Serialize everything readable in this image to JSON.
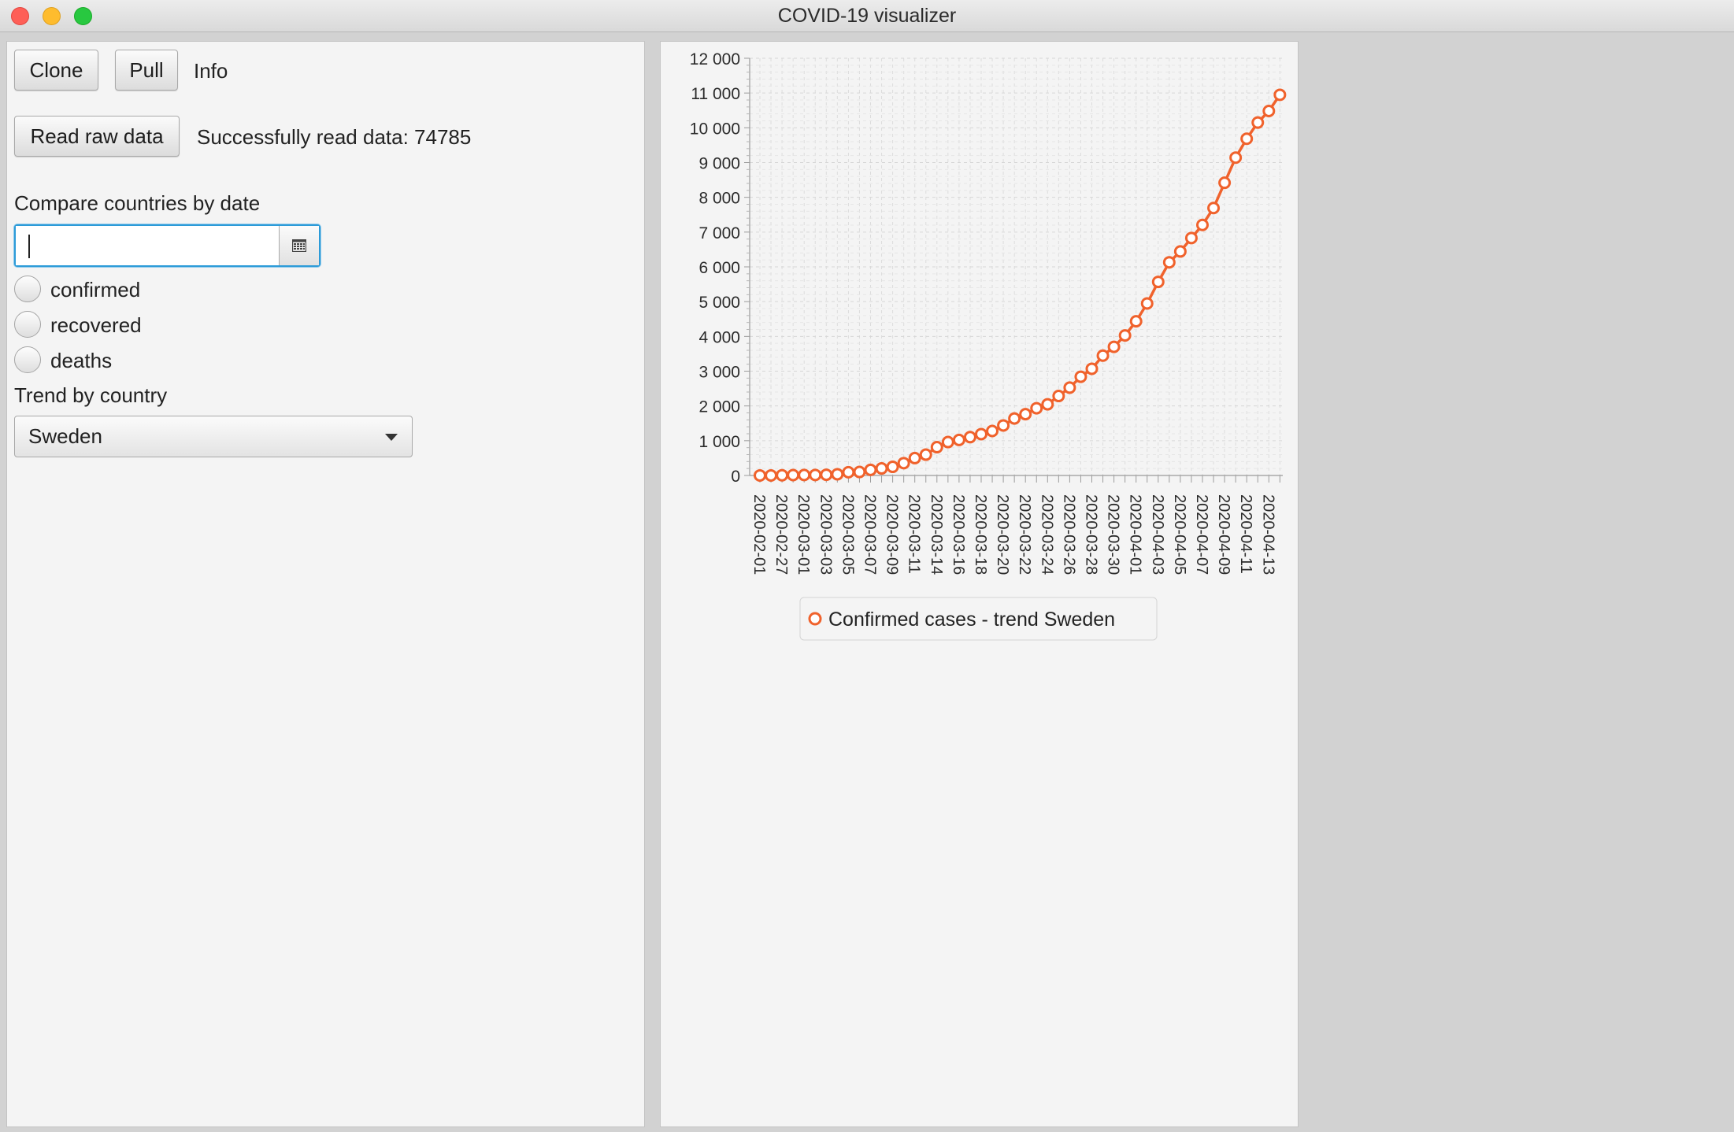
{
  "window": {
    "title": "COVID-19 visualizer"
  },
  "toolbar": {
    "clone_label": "Clone",
    "pull_label": "Pull",
    "info_label": "Info",
    "read_label": "Read raw data",
    "status_text": "Successfully read data: 74785"
  },
  "compare": {
    "heading": "Compare countries by date",
    "date_value": "",
    "calendar_icon": "calendar-icon",
    "radios": [
      {
        "label": "confirmed",
        "selected": false
      },
      {
        "label": "recovered",
        "selected": false
      },
      {
        "label": "deaths",
        "selected": false
      }
    ]
  },
  "trend": {
    "heading": "Trend by country",
    "selected_country": "Sweden"
  },
  "colors": {
    "series": "#f0622c",
    "focus": "#2c9bd8"
  },
  "chart_data": {
    "type": "line",
    "title": "",
    "xlabel": "",
    "ylabel": "",
    "ylim": [
      0,
      12000
    ],
    "yticks": [
      0,
      1000,
      2000,
      3000,
      4000,
      5000,
      6000,
      7000,
      8000,
      9000,
      10000,
      11000,
      12000
    ],
    "ytick_labels": [
      "0",
      "1 000",
      "2 000",
      "3 000",
      "4 000",
      "5 000",
      "6 000",
      "7 000",
      "8 000",
      "9 000",
      "10 000",
      "11 000",
      "12 000"
    ],
    "grid": true,
    "legend": "bottom",
    "x_tick_labels": [
      "2020-02-01",
      "2020-02-27",
      "2020-03-01",
      "2020-03-03",
      "2020-03-05",
      "2020-03-07",
      "2020-03-09",
      "2020-03-11",
      "2020-03-14",
      "2020-03-16",
      "2020-03-18",
      "2020-03-20",
      "2020-03-22",
      "2020-03-24",
      "2020-03-26",
      "2020-03-28",
      "2020-03-30",
      "2020-04-01",
      "2020-04-03",
      "2020-04-05",
      "2020-04-07",
      "2020-04-09",
      "2020-04-11",
      "2020-04-13"
    ],
    "series": [
      {
        "name": "Confirmed cases - trend Sweden",
        "values": [
          1,
          1,
          7,
          12,
          14,
          15,
          21,
          35,
          94,
          101,
          161,
          203,
          248,
          355,
          500,
          599,
          814,
          961,
          1022,
          1103,
          1190,
          1279,
          1439,
          1639,
          1763,
          1934,
          2046,
          2286,
          2526,
          2840,
          3069,
          3447,
          3700,
          4028,
          4435,
          4947,
          5568,
          6131,
          6443,
          6830,
          7206,
          7693,
          8419,
          9141,
          9685,
          10151,
          10483,
          10948
        ]
      }
    ]
  }
}
